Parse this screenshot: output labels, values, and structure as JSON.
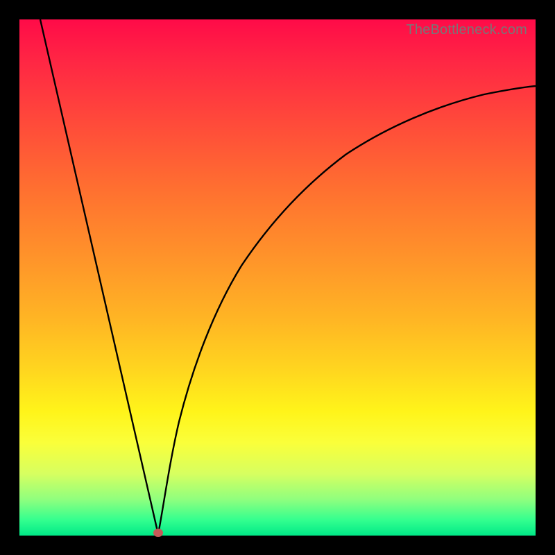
{
  "watermark": "TheBottleneck.com",
  "colors": {
    "frame": "#000000",
    "curve": "#000000",
    "marker": "#c65a5a",
    "gradient_top": "#ff0b48",
    "gradient_bottom": "#00e887"
  },
  "chart_data": {
    "type": "line",
    "title": "",
    "xlabel": "",
    "ylabel": "",
    "xlim": [
      0,
      100
    ],
    "ylim": [
      0,
      100
    ],
    "grid": false,
    "annotations": [
      "TheBottleneck.com"
    ],
    "marker": {
      "x": 27,
      "y": 0
    },
    "series": [
      {
        "name": "left-line",
        "x": [
          4,
          27
        ],
        "values": [
          100,
          0
        ]
      },
      {
        "name": "right-curve",
        "x": [
          27,
          30,
          33,
          36,
          40,
          45,
          50,
          55,
          60,
          65,
          70,
          75,
          80,
          85,
          90,
          95,
          100
        ],
        "values": [
          0,
          12,
          22,
          30,
          39,
          49,
          56,
          62,
          67,
          71,
          74,
          77,
          79,
          81,
          83,
          84.5,
          86
        ]
      }
    ]
  }
}
